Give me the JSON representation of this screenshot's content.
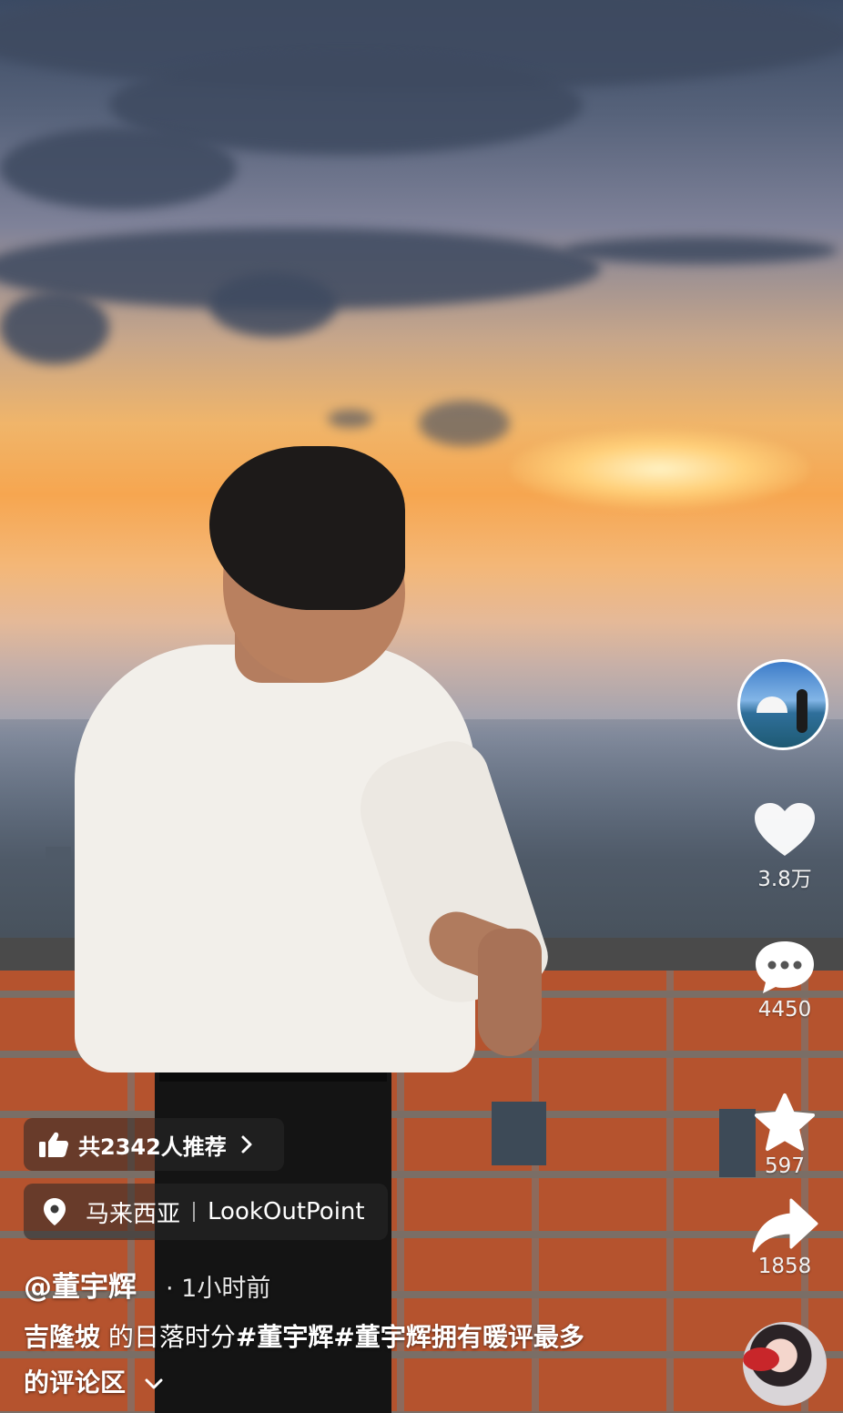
{
  "side_rail": {
    "author_avatar": "author-avatar-photo",
    "like": {
      "icon": "heart-icon",
      "count": "3.8万"
    },
    "comment": {
      "icon": "comment-bubble-icon",
      "count": "4450"
    },
    "favorite": {
      "icon": "star-icon",
      "count": "597"
    },
    "share": {
      "icon": "share-arrow-icon",
      "count": "1858"
    }
  },
  "recommend": {
    "icon": "thumbs-up-icon",
    "label": "共2342人推荐",
    "chevron": "chevron-right-icon"
  },
  "location": {
    "icon": "location-pin-icon",
    "country": "马来西亚",
    "place": "LookOutPoint"
  },
  "post": {
    "author": "@董宇辉",
    "time": "· 1小时前",
    "caption_location": "吉隆坡",
    "caption_text": " 的日落时分",
    "hashtag_1": "#董宇辉",
    "hashtag_2": "#董宇辉拥有暖评最多",
    "caption_tail": "的评论区",
    "expand_icon": "chevron-down-icon"
  },
  "music_disc": "music-disc-avatar",
  "colors": {
    "overlay_pill": "#282828",
    "text": "#ffffff",
    "heart_fill": "#ffffff"
  }
}
